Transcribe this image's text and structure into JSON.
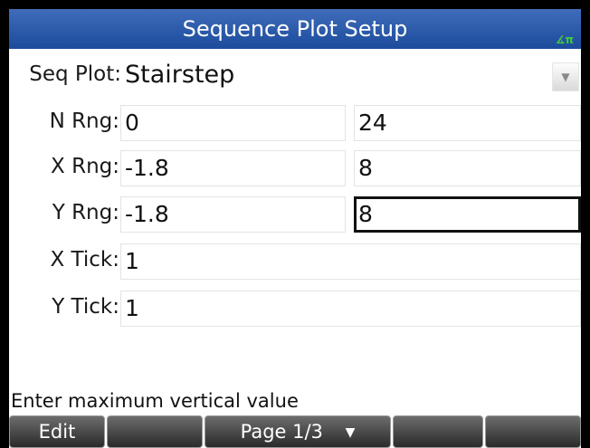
{
  "title": "Sequence Plot Setup",
  "angle_indicator": "∡π",
  "seq_plot": {
    "label": "Seq Plot:",
    "value": "Stairstep"
  },
  "n_rng": {
    "label": "N Rng:",
    "min": "0",
    "max": "24"
  },
  "x_rng": {
    "label": "X Rng:",
    "min": "-1.8",
    "max": "8"
  },
  "y_rng": {
    "label": "Y Rng:",
    "min": "-1.8",
    "max": "8"
  },
  "x_tick": {
    "label": "X Tick:",
    "value": "1"
  },
  "y_tick": {
    "label": "Y Tick:",
    "value": "1"
  },
  "status": "Enter maximum vertical value",
  "softkeys": {
    "edit": "Edit",
    "page": "Page 1/3",
    "page_marker": "▼"
  },
  "colors": {
    "titlebar": "#2a58a8",
    "focus_border": "#111111",
    "softkey": "#404040"
  }
}
